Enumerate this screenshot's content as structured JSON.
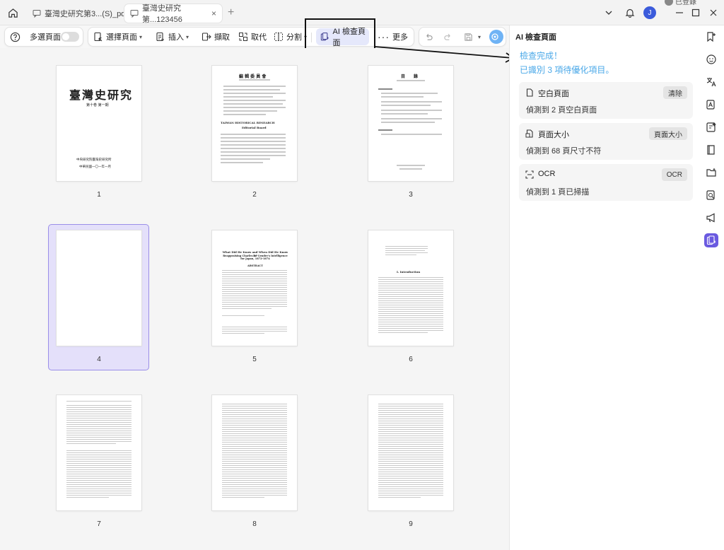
{
  "titlebar": {
    "tabs": [
      {
        "label": "臺灣史研究第3...(S)_pdf",
        "active": false
      },
      {
        "label": "臺灣史研究第...123456",
        "active": true
      }
    ],
    "avatar_letter": "J",
    "user_name": "已登錄"
  },
  "toolbar": {
    "multi_page_label": "多選頁面",
    "select_pages_label": "選擇頁面",
    "insert_label": "插入",
    "extract_label": "擷取",
    "replace_label": "取代",
    "split_label": "分割",
    "ai_check_label": "AI 檢查頁面",
    "more_label": "更多"
  },
  "pages": [
    {
      "num": "1"
    },
    {
      "num": "2"
    },
    {
      "num": "3"
    },
    {
      "num": "4",
      "selected": true
    },
    {
      "num": "5"
    },
    {
      "num": "6"
    },
    {
      "num": "7"
    },
    {
      "num": "8"
    },
    {
      "num": "9"
    }
  ],
  "page_content": {
    "p1_title": "臺灣史研究",
    "p1_sub": "第十卷 第一期",
    "p1_pub": "中央研究院臺灣史研究所",
    "p1_date": "中華民國一〇一年一月",
    "p2_title": "編 輯 委 員 會",
    "p2_en_title": "TAIWAN HISTORICAL RESEARCH",
    "p2_en_sub": "Editorial Board",
    "p3_title": "目　　錄",
    "p5_title": "What Did He Know and When Did He Know It?",
    "p5_sub": "Reappraising Charles Le Gendre's Intelligence for Japan, 1872-1874",
    "p5_abstract": "ABSTRACT",
    "p6_heading": "I. Introduction"
  },
  "panel": {
    "title": "AI 檢查頁面",
    "status_done": "檢查完成！",
    "status_found": "已識別 3 項待優化項目。",
    "cards": [
      {
        "title": "空白頁面",
        "action": "清除",
        "desc": "偵測到 2 頁空白頁面",
        "icon": "blank-page-icon"
      },
      {
        "title": "頁面大小",
        "action": "頁面大小",
        "desc": "偵測到 68 頁尺寸不符",
        "icon": "page-size-icon"
      },
      {
        "title": "OCR",
        "action": "OCR",
        "desc": "偵測到 1 頁已掃描",
        "icon": "ocr-scan-icon"
      }
    ]
  },
  "colors": {
    "accent": "#6a5ae0",
    "status_blue": "#4aa8e8",
    "selected_bg": "#e4e0fa"
  }
}
